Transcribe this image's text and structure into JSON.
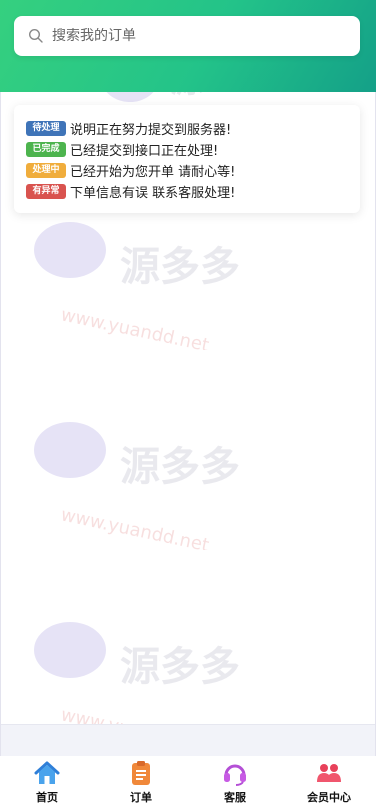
{
  "search": {
    "placeholder": "搜索我的订单",
    "value": ""
  },
  "legend": [
    {
      "badge": "待处理",
      "color": "#3f74b8",
      "text": "说明正在努力提交到服务器!"
    },
    {
      "badge": "已完成",
      "color": "#4db44e",
      "text": "已经提交到接口正在处理!"
    },
    {
      "badge": "处理中",
      "color": "#f0ad3c",
      "text": "已经开始为您开单 请耐心等!"
    },
    {
      "badge": "有异常",
      "color": "#d9534f",
      "text": "下单信息有误 联系客服处理!"
    }
  ],
  "tabs": [
    {
      "label": "首页",
      "icon": "home-icon"
    },
    {
      "label": "订单",
      "icon": "order-clipboard-icon"
    },
    {
      "label": "客服",
      "icon": "headset-icon"
    },
    {
      "label": "会员中心",
      "icon": "members-icon"
    }
  ],
  "watermark": {
    "text": "源多多",
    "url": "www.yuanddnet"
  }
}
